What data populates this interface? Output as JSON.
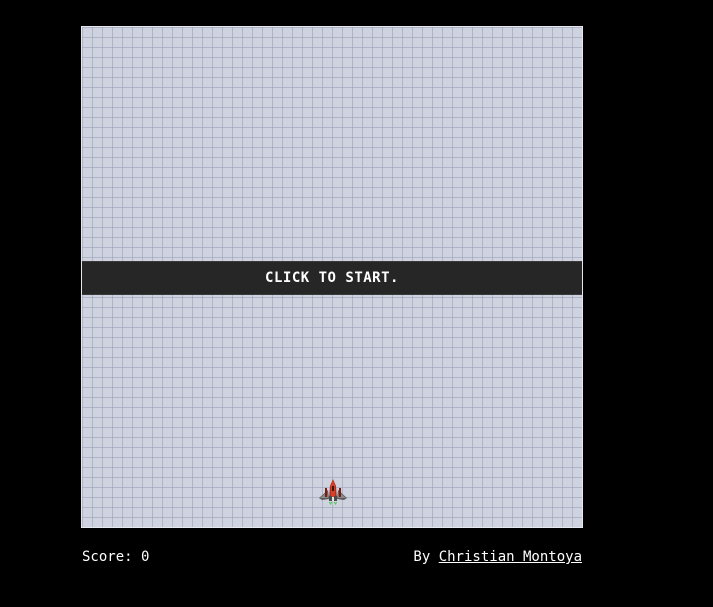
{
  "game": {
    "start_prompt": "CLICK TO START.",
    "player_icon": "spaceship-icon"
  },
  "footer": {
    "score_label": "Score:",
    "score_value": "0",
    "by_label": "By",
    "author_name": "Christian Montoya"
  },
  "colors": {
    "page_background": "#000000",
    "board_background": "#cfd3e0",
    "banner_background": "#262626",
    "text": "#ffffff"
  }
}
